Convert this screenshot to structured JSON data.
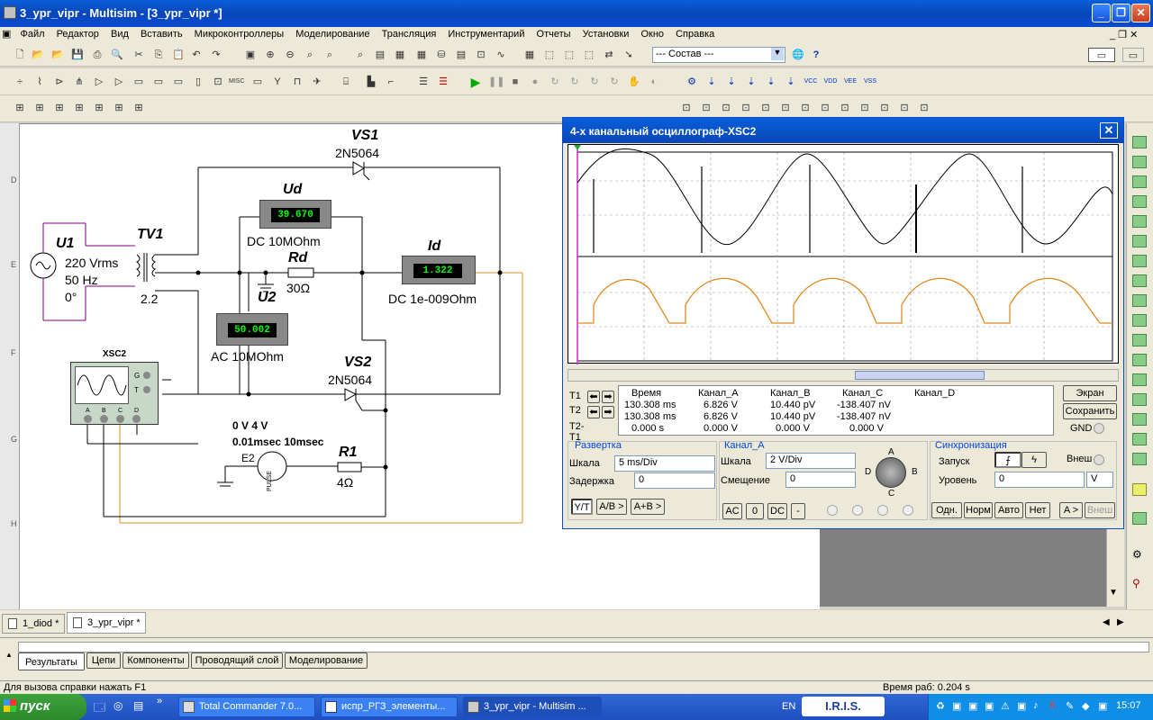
{
  "window": {
    "title": "3_ypr_vipr - Multisim - [3_ypr_vipr *]"
  },
  "menu": [
    "Файл",
    "Редактор",
    "Вид",
    "Вставить",
    "Микроконтроллеры",
    "Моделирование",
    "Трансляция",
    "Инструментарий",
    "Отчеты",
    "Установки",
    "Окно",
    "Справка"
  ],
  "toolbar": {
    "combo_value": "--- Состав ---"
  },
  "ruler": [
    "D",
    "E",
    "F",
    "G",
    "H"
  ],
  "circuit": {
    "u1": {
      "name": "U1",
      "voltage": "220 Vrms",
      "freq": "50 Hz",
      "phase": "0°"
    },
    "tv1": {
      "name": "TV1",
      "ratio": "2.2"
    },
    "vs1": {
      "name": "VS1",
      "part": "2N5064"
    },
    "vs2": {
      "name": "VS2",
      "part": "2N5064"
    },
    "ud": {
      "name": "Ud",
      "value": "39.670",
      "desc": "DC  10MOhm"
    },
    "u2": {
      "name": "U2",
      "value": "50.002",
      "desc": "AC  10MOhm"
    },
    "id": {
      "name": "Id",
      "value": "1.322",
      "desc": "DC  1e-009Ohm"
    },
    "rd": {
      "name": "Rd",
      "value": "30Ω"
    },
    "r1": {
      "name": "R1",
      "value": "4Ω"
    },
    "e2": {
      "name": "E2",
      "line1": "0 V 4 V",
      "line2": "0.01msec 10msec",
      "pulse": "PULSE"
    },
    "xsc2": {
      "name": "XSC2",
      "pins": [
        "A",
        "B",
        "C",
        "D"
      ],
      "side": [
        "G",
        "T"
      ]
    }
  },
  "scope": {
    "title": "4-х канальный осциллограф-XSC2",
    "table": {
      "headers": [
        "Время",
        "Канал_A",
        "Канал_B",
        "Канал_C",
        "Канал_D"
      ],
      "rows": [
        {
          "label": "T1",
          "vals": [
            "130.308 ms",
            "6.826 V",
            "10.440 pV",
            "-138.407 nV",
            ""
          ]
        },
        {
          "label": "T2",
          "vals": [
            "130.308 ms",
            "6.826 V",
            "10.440 pV",
            "-138.407 nV",
            ""
          ]
        },
        {
          "label": "T2-T1",
          "vals": [
            "0.000 s",
            "0.000 V",
            "0.000 V",
            "0.000 V",
            ""
          ]
        }
      ]
    },
    "btn_screen": "Экран",
    "btn_save": "Сохранить",
    "gnd": "GND",
    "sweep": {
      "title": "Развертка",
      "scale_lbl": "Шкала",
      "scale": "5 ms/Div",
      "delay_lbl": "Задержка",
      "delay": "0",
      "btns": [
        "Y/T",
        "A/B >",
        "A+B >"
      ]
    },
    "channel": {
      "title": "Канал_A",
      "scale_lbl": "Шкала",
      "scale": "2  V/Div",
      "offset_lbl": "Смещение",
      "offset": "0",
      "btns": [
        "AC",
        "0",
        "DC",
        "-"
      ],
      "knob": [
        "A",
        "B",
        "C",
        "D"
      ]
    },
    "trigger": {
      "title": "Синхронизация",
      "start_lbl": "Запуск",
      "ext": "Внеш",
      "level_lbl": "Уровень",
      "level": "0",
      "unit": "V",
      "btns": [
        "Одн.",
        "Норм",
        "Авто",
        "Нет",
        "A >",
        "Внеш"
      ]
    }
  },
  "doc_tabs": [
    "1_diod *",
    "3_ypr_vipr *"
  ],
  "bottom_tabs": [
    "Результаты",
    "Цепи",
    "Компоненты",
    "Проводящий слой",
    "Моделирование"
  ],
  "status": {
    "help": "Для вызова справки нажать F1",
    "runtime": "Время раб: 0.204 s"
  },
  "taskbar": {
    "start": "пуск",
    "tasks": [
      "Total Commander 7.0...",
      "испр_РГЗ_элементы...",
      "3_ypr_vipr - Multisim ..."
    ],
    "lang": "EN",
    "iris": "I.R.I.S.",
    "clock": "15:07"
  },
  "colors": {
    "chA": "#000000",
    "chB": "#e08a1e"
  }
}
